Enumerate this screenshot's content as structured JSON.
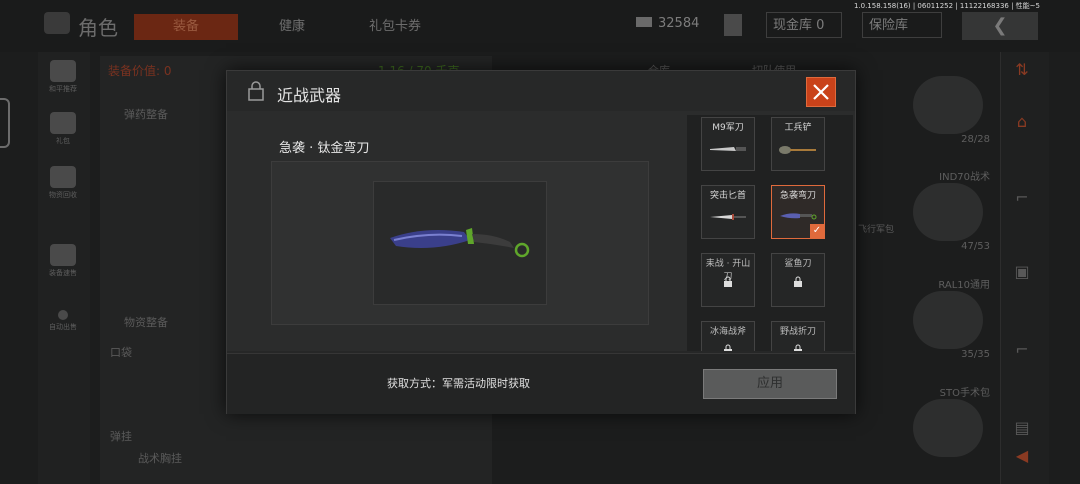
{
  "version_text": "1.0.158.158(16) | 06011252 | 11122168336 | 性能~5",
  "topbar": {
    "title": "角色",
    "tabs": [
      "装备",
      "健康",
      "礼包卡券"
    ],
    "currency": "32584",
    "cash_label": "现金库 0",
    "safe_label": "保险库"
  },
  "left_panel": {
    "value_label": "装备价值: 0",
    "weight_label": "1.16 / 70 千克",
    "ammo_section": "弹药整备",
    "supply_section": "物资整备",
    "pocket": "口袋",
    "chest_rig": "弹挂",
    "chest_rig_item": "战术胸挂"
  },
  "sidebar": [
    {
      "label": "和平推荐",
      "icon": "gun-icon"
    },
    {
      "label": "礼包",
      "icon": "gift-icon"
    },
    {
      "label": "物资回收",
      "icon": "recycle-icon"
    },
    {
      "label": "装备速售",
      "icon": "helmet-icon"
    },
    {
      "label": "自动出售",
      "icon": "dot-icon"
    }
  ],
  "right_panel": {
    "tabs": [
      "仓库",
      "切队使用"
    ],
    "helmet_count": "28/28",
    "helmet2_name": "IND70战术",
    "helmet2_count": "47/53",
    "mask_name": "RAL10通用",
    "mask_count": "35/35",
    "bag_name": "STO手术包",
    "side_text": "飞行军包"
  },
  "modal": {
    "title": "近战武器",
    "item_name": "急袭 · 钛金弯刀",
    "acquire_text": "获取方式：军需活动限时获取",
    "apply_label": "应用",
    "melee_list": [
      {
        "name": "M9军刀",
        "locked": false,
        "selected": false
      },
      {
        "name": "工兵铲",
        "locked": false,
        "selected": false
      },
      {
        "name": "突击匕首",
        "locked": false,
        "selected": false
      },
      {
        "name": "急袭弯刀",
        "locked": false,
        "selected": true
      },
      {
        "name": "耒战 · 开山刀",
        "locked": true,
        "selected": false
      },
      {
        "name": "鲨鱼刀",
        "locked": true,
        "selected": false
      },
      {
        "name": "冰海战斧",
        "locked": true,
        "selected": false
      },
      {
        "name": "野战折刀",
        "locked": true,
        "selected": false
      }
    ]
  },
  "colors": {
    "accent": "#e06a3c",
    "modal_bg": "#262727",
    "green": "#5fa62b"
  }
}
